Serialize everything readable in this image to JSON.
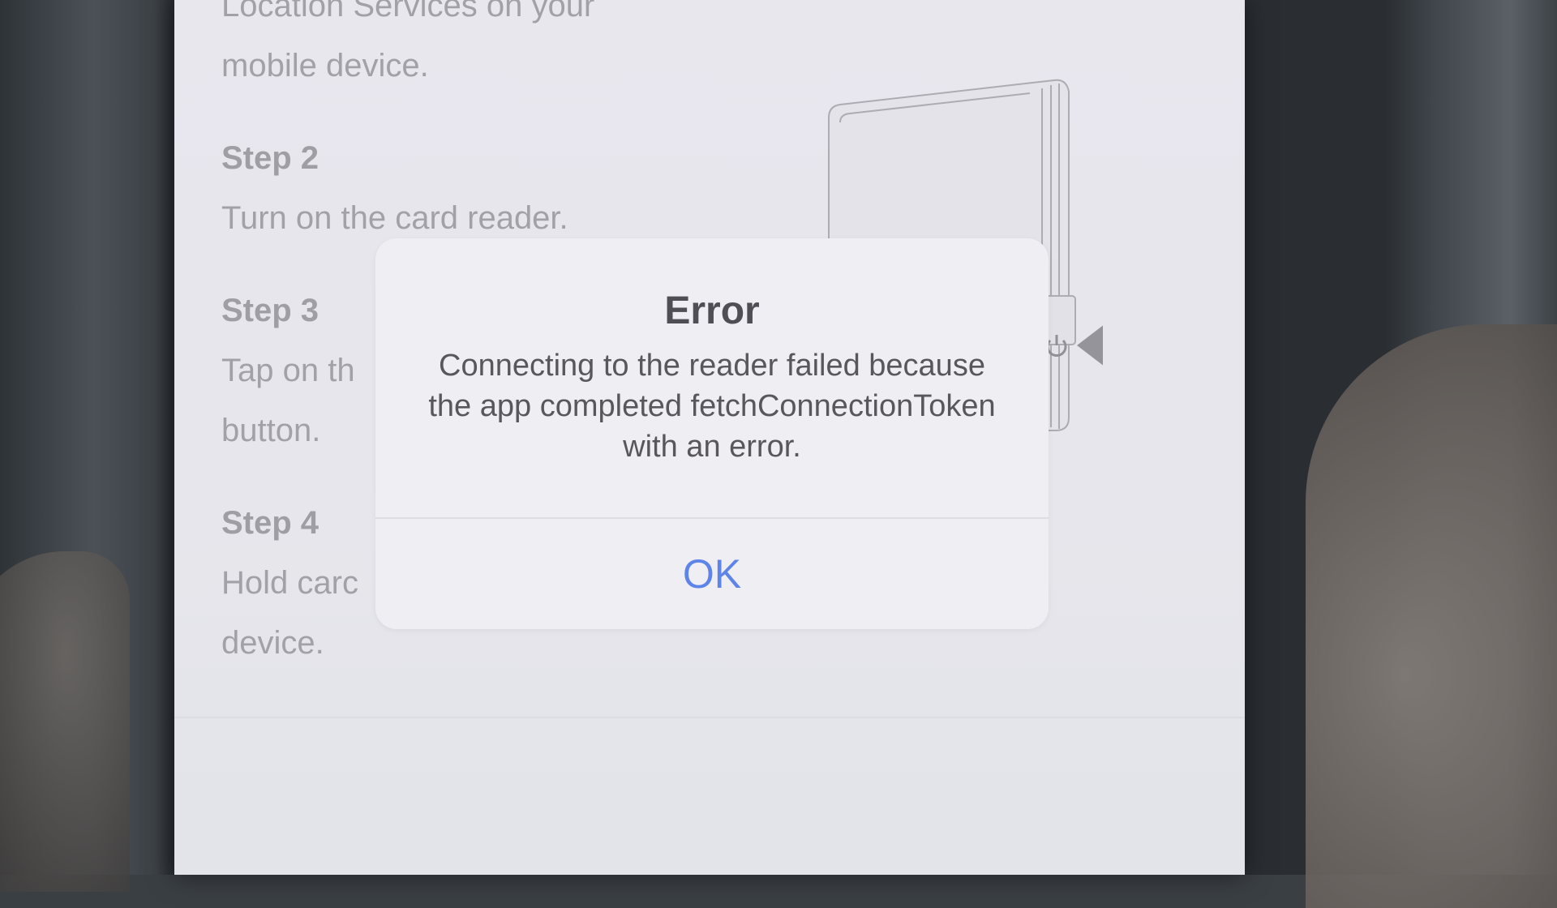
{
  "instructions": {
    "intro_line1": "Location Services on your",
    "intro_line2": "mobile device.",
    "step2": {
      "heading": "Step 2",
      "line1": "Turn on the card reader."
    },
    "step3": {
      "heading": "Step 3",
      "line1": "Tap on th",
      "line2": "button."
    },
    "step4": {
      "heading": "Step 4",
      "line1": "Hold carc",
      "line2": "device."
    }
  },
  "illustration": {
    "icon": "power-icon",
    "arrow": "arrow-left-icon"
  },
  "alert": {
    "title": "Error",
    "message": "Connecting to the reader failed because the app completed fetchConnectionToken with an error.",
    "ok_label": "OK",
    "accent_color": "#5e84e9"
  }
}
